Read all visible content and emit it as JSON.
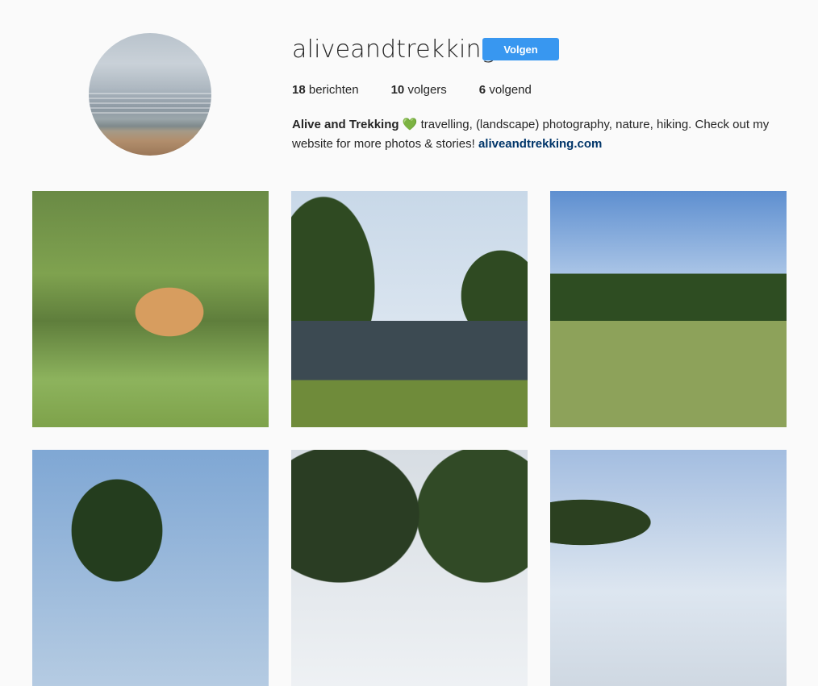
{
  "profile": {
    "username": "aliveandtrekking",
    "follow_label": "Volgen",
    "stats": [
      {
        "count": "18",
        "label": "berichten"
      },
      {
        "count": "10",
        "label": "volgers"
      },
      {
        "count": "6",
        "label": "volgend"
      }
    ],
    "bio": {
      "name": "Alive and Trekking",
      "heart": "💚",
      "text": " travelling, (landscape) photography, nature, hiking. Check out my website for more photos & stories! ",
      "link": "aliveandtrekking.com"
    }
  },
  "posts": [
    {
      "subject": "deer grazing in grass"
    },
    {
      "subject": "canal lined with trees"
    },
    {
      "subject": "meadow with trees and path"
    },
    {
      "subject": "tree against blue sky"
    },
    {
      "subject": "trees and sky"
    },
    {
      "subject": "treeline under cloudy sky"
    }
  ]
}
